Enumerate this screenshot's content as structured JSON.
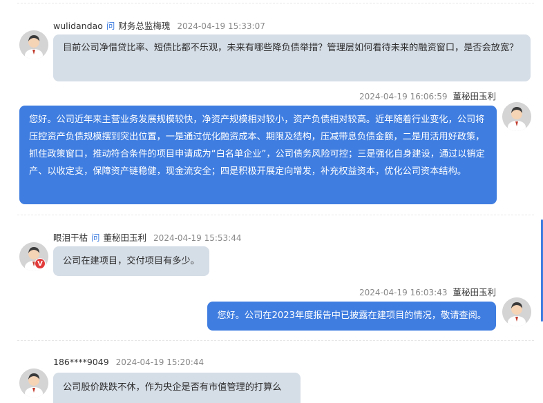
{
  "messages": [
    {
      "question": {
        "asker": "wulidandao",
        "ask_label": "问",
        "target": "财务总监梅瑰",
        "time": "2024-04-19 15:33:07",
        "text": "目前公司净借贷比率、短债比都不乐观，未来有哪些降负债举措？管理层如何看待未来的融资窗口，是否会放宽？"
      },
      "answer": {
        "time": "2024-04-19 16:06:59",
        "responder": "董秘田玉利",
        "text": "您好。公司近年来主营业务发展规模较快，净资产规模相对较小，资产负债相对较高。近年随着行业变化，公司将压控资产负债规模摆到突出位置，一是通过优化融资成本、期限及结构，压减带息负债金额，二是用活用好政策，抓住政策窗口，推动符合条件的项目申请成为“白名单企业”，公司债务风险可控；三是强化自身建设，通过以销定产、以收定支，保障资产链稳健，现金流安全；四是积极开展定向增发，补充权益资本，优化公司资本结构。"
      }
    },
    {
      "question": {
        "asker": "眼泪干枯",
        "ask_label": "问",
        "target": "董秘田玉利",
        "time": "2024-04-19 15:53:44",
        "text": "公司在建项目，交付项目有多少。",
        "badge": "V"
      },
      "answer": {
        "time": "2024-04-19 16:03:43",
        "responder": "董秘田玉利",
        "text": "您好。公司在2023年度报告中已披露在建项目的情况，敬请查阅。"
      }
    },
    {
      "question": {
        "asker": "186****9049",
        "time": "2024-04-19 15:20:44",
        "text": "公司股价跌跌不休，作为央企是否有市值管理的打算么"
      }
    }
  ],
  "colors": {
    "question_bubble": "#d5dde6",
    "answer_bubble": "#3f7de0",
    "ask_icon": "#3f7de0",
    "badge": "#e23b3b"
  },
  "icons": {
    "avatar": "user-avatar-icon",
    "verified_badge": "verified-badge-icon"
  }
}
